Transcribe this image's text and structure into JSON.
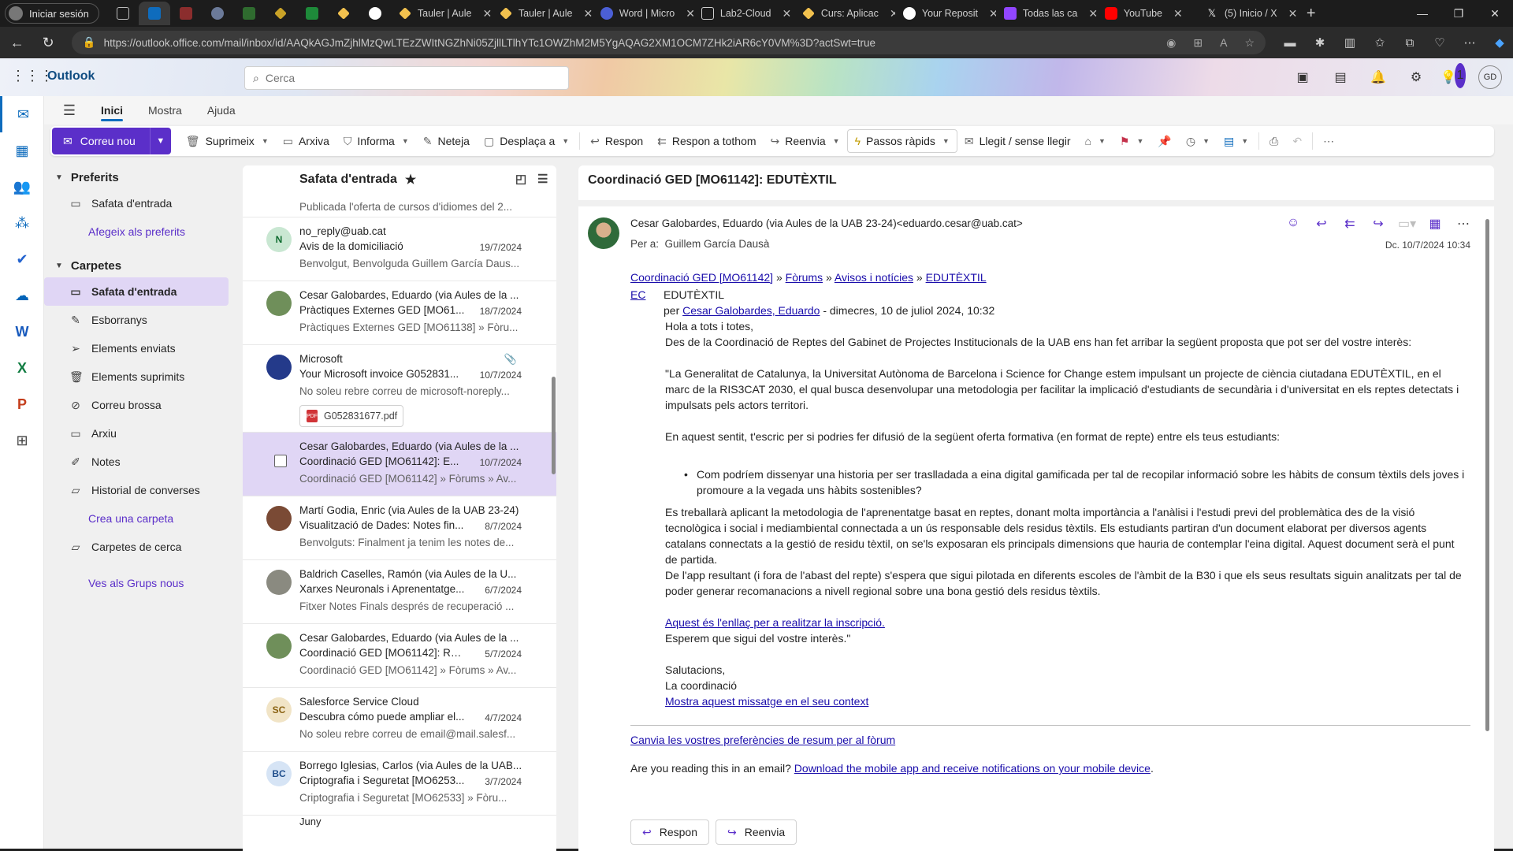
{
  "browser": {
    "signin_label": "Iniciar sesión",
    "tabs": [
      {
        "label": "Tauler | Aule",
        "color": "#f2c14e"
      },
      {
        "label": "Tauler | Aule",
        "color": "#f2c14e"
      },
      {
        "label": "Word | Micro",
        "color": "#4b5fd6"
      },
      {
        "label": "Lab2-Cloud",
        "color": "#cfcfcf"
      },
      {
        "label": "Curs: Aplicac",
        "color": "#f2c14e"
      },
      {
        "label": "Your Reposit",
        "color": "#ffffff"
      },
      {
        "label": "Todas las ca",
        "color": "#9146ff"
      },
      {
        "label": "YouTube",
        "color": "#ff0000"
      },
      {
        "label": "(5) Inicio / X",
        "color": "#ffffff"
      }
    ],
    "url": "https://outlook.office.com/mail/inbox/id/AAQkAGJmZjhlMzQwLTEzZWItNGZhNi05ZjllLTlhYTc1OWZhM2M5YgAQAG2XM1OCM7ZHk2iAR6cY0VM%3D?actSwt=true"
  },
  "header": {
    "app_name": "Outlook",
    "search_placeholder": "Cerca",
    "notification_count": "1",
    "user_initials": "GD"
  },
  "ribbon": {
    "tabs": [
      "Inici",
      "Mostra",
      "Ajuda"
    ],
    "new_mail": "Correu nou",
    "commands": {
      "delete": "Suprimeix",
      "archive": "Arxiva",
      "report": "Informa",
      "sweep": "Neteja",
      "move": "Desplaça a",
      "reply": "Respon",
      "reply_all": "Respon a tothom",
      "forward": "Reenvia",
      "quick_steps": "Passos ràpids",
      "read_unread": "Llegit / sense llegir"
    }
  },
  "folders": {
    "favorites_header": "Preferits",
    "favorites": [
      "Safata d'entrada"
    ],
    "add_favorite": "Afegeix als preferits",
    "folders_header": "Carpetes",
    "items": [
      "Safata d'entrada",
      "Esborranys",
      "Elements enviats",
      "Elements suprimits",
      "Correu brossa",
      "Arxiu",
      "Notes",
      "Historial de converses"
    ],
    "create_folder": "Crea una carpeta",
    "search_folders": "Carpetes de cerca",
    "groups_link": "Ves als Grups nous"
  },
  "message_list": {
    "title": "Safata d'entrada",
    "partial_top_preview": "Publicada l'oferta de cursos d'idiomes del 2...",
    "messages": [
      {
        "from": "no_reply@uab.cat",
        "subject": "Avis de la domiciliació",
        "date": "19/7/2024",
        "preview": "Benvolgut, Benvolguda Guillem García Daus...",
        "initials": "N",
        "avatar_color": "#c9e7d2",
        "avatar_text": "#0e6b2f"
      },
      {
        "from": "Cesar Galobardes, Eduardo (via Aules de la ...",
        "subject": "Pràctiques Externes GED [MO61...",
        "date": "18/7/2024",
        "preview": "Pràctiques Externes GED [MO61138] » Fòru...",
        "initials": "",
        "avatar_color": "#6f8f5a",
        "avatar_text": "#fff"
      },
      {
        "from": "Microsoft",
        "subject": "Your Microsoft invoice G052831...",
        "date": "10/7/2024",
        "preview": "No soleu rebre correu de microsoft-noreply...",
        "initials": "",
        "avatar_color": "#243a8a",
        "avatar_text": "#fff",
        "attachment": "G052831677.pdf"
      },
      {
        "from": "Cesar Galobardes, Eduardo (via Aules de la ...",
        "subject": "Coordinació GED [MO61142]: E...",
        "date": "10/7/2024",
        "preview": "Coordinació GED [MO61142] » Fòrums » Av...",
        "initials": "",
        "avatar_color": "#6f8f5a",
        "avatar_text": "#fff",
        "selected": true
      },
      {
        "from": "Martí Godia, Enric (via Aules de la UAB 23-24)",
        "subject": "Visualització de Dades: Notes fin...",
        "date": "8/7/2024",
        "preview": "Benvolguts: Finalment ja tenim les notes de...",
        "initials": "",
        "avatar_color": "#7a4a35",
        "avatar_text": "#fff"
      },
      {
        "from": "Baldrich Caselles, Ramón (via Aules de la U...",
        "subject": "Xarxes Neuronals i Aprenentatge...",
        "date": "6/7/2024",
        "preview": "Fitxer Notes Finals després de recuperació ...",
        "initials": "",
        "avatar_color": "#8a8a80",
        "avatar_text": "#fff"
      },
      {
        "from": "Cesar Galobardes, Eduardo (via Aules de la ...",
        "subject": "Coordinació GED [MO61142]: Re:...",
        "date": "5/7/2024",
        "preview": "Coordinació GED [MO61142] » Fòrums » Av...",
        "initials": "",
        "avatar_color": "#6f8f5a",
        "avatar_text": "#fff"
      },
      {
        "from": "Salesforce Service Cloud",
        "subject": "Descubra cómo puede ampliar el...",
        "date": "4/7/2024",
        "preview": "No soleu rebre correu de email@mail.salesf...",
        "initials": "SC",
        "avatar_color": "#f1e4c6",
        "avatar_text": "#8a6212"
      },
      {
        "from": "Borrego Iglesias, Carlos (via Aules de la UAB...",
        "subject": "Criptografia i Seguretat [MO6253...",
        "date": "3/7/2024",
        "preview": "Criptografia i Seguretat [MO62533] » Fòru...",
        "initials": "BC",
        "avatar_color": "#d6e4f5",
        "avatar_text": "#1f4e8c"
      }
    ],
    "partial_bottom_label": "Juny"
  },
  "reading_pane": {
    "subject": "Coordinació GED [MO61142]: EDUTÈXTIL",
    "from": "Cesar Galobardes, Eduardo (via Aules de la UAB 23-24)<eduardo.cesar@uab.cat>",
    "to_label": "Per a:",
    "to": "Guillem García Dausà",
    "date": "Dc. 10/7/2024 10:34",
    "breadcrumb": [
      "Coordinació GED [MO61142]",
      "Fòrums",
      "Avisos i notícies",
      "EDUTÈXTIL"
    ],
    "breadcrumb_sep": " » ",
    "ec_badge": "EC",
    "post_title": "EDUTÈXTIL",
    "by_prefix": "per ",
    "author": "Cesar Galobardes, Eduardo",
    "posted": " - dimecres, 10 de juliol 2024, 10:32",
    "greeting": "Hola a tots i totes,",
    "p1": "Des de la Coordinació de Reptes del Gabinet de Projectes Institucionals de la UAB ens han fet arribar la següent proposta que pot ser del vostre interès:",
    "p2": "\"La Generalitat de Catalunya, la Universitat Autònoma de Barcelona i Science for Change estem impulsant un projecte de ciència ciutadana EDUTÈXTIL, en el marc de la RIS3CAT 2030, el qual busca desenvolupar una metodologia per facilitar la implicació d'estudiants de secundària i d'universitat en els reptes detectats i impulsats pels actors territori.",
    "p3": "En aquest sentit, t'escric per si podries fer difusió  de la següent oferta formativa (en format de repte) entre els teus estudiants:",
    "bullet": "Com podríem dissenyar una historia per ser traslladada a eina digital gamificada per tal de recopilar informació sobre les hàbits de consum tèxtils dels joves i promoure  a la vegada uns hàbits sostenibles?",
    "p4": "Es treballarà aplicant la metodologia de l'aprenentatge basat en reptes, donant molta importància a l'anàlisi i l'estudi previ del problemàtica des de la visió tecnològica i social  i mediambiental connectada a un ús responsable dels residus tèxtils. Els estudiants partiran d'un document elaborat per diversos agents catalans connectats a la gestió de residu tèxtil, on se'ls exposaran els principals  dimensions  que hauria de contemplar l'eina digital. Aquest document serà el punt de partida.",
    "p5": "De l'app resultant (i fora de l'abast del repte) s'espera que sigui pilotada en diferents escoles de l'àmbit de la B30 i que els seus resultats siguin analitzats per tal de poder generar recomanacions a nivell regional sobre una bona gestió dels residus tèxtils.",
    "signup_link": "Aquest és l'enllaç per a realitzar la inscripció. ",
    "hope": "Esperem que sigui del vostre interès.\"",
    "regards": "Salutacions,",
    "signature": "La coordinació",
    "context_link": "Mostra aquest missatge en el seu context",
    "prefs_link": "Canvia les vostres preferències de resum per al fòrum",
    "mobile_q": "Are you reading this in an email? ",
    "mobile_link": "Download the mobile app and receive notifications on your mobile device",
    "mobile_end": ".",
    "reply_btn": "Respon",
    "forward_btn": "Reenvia"
  }
}
